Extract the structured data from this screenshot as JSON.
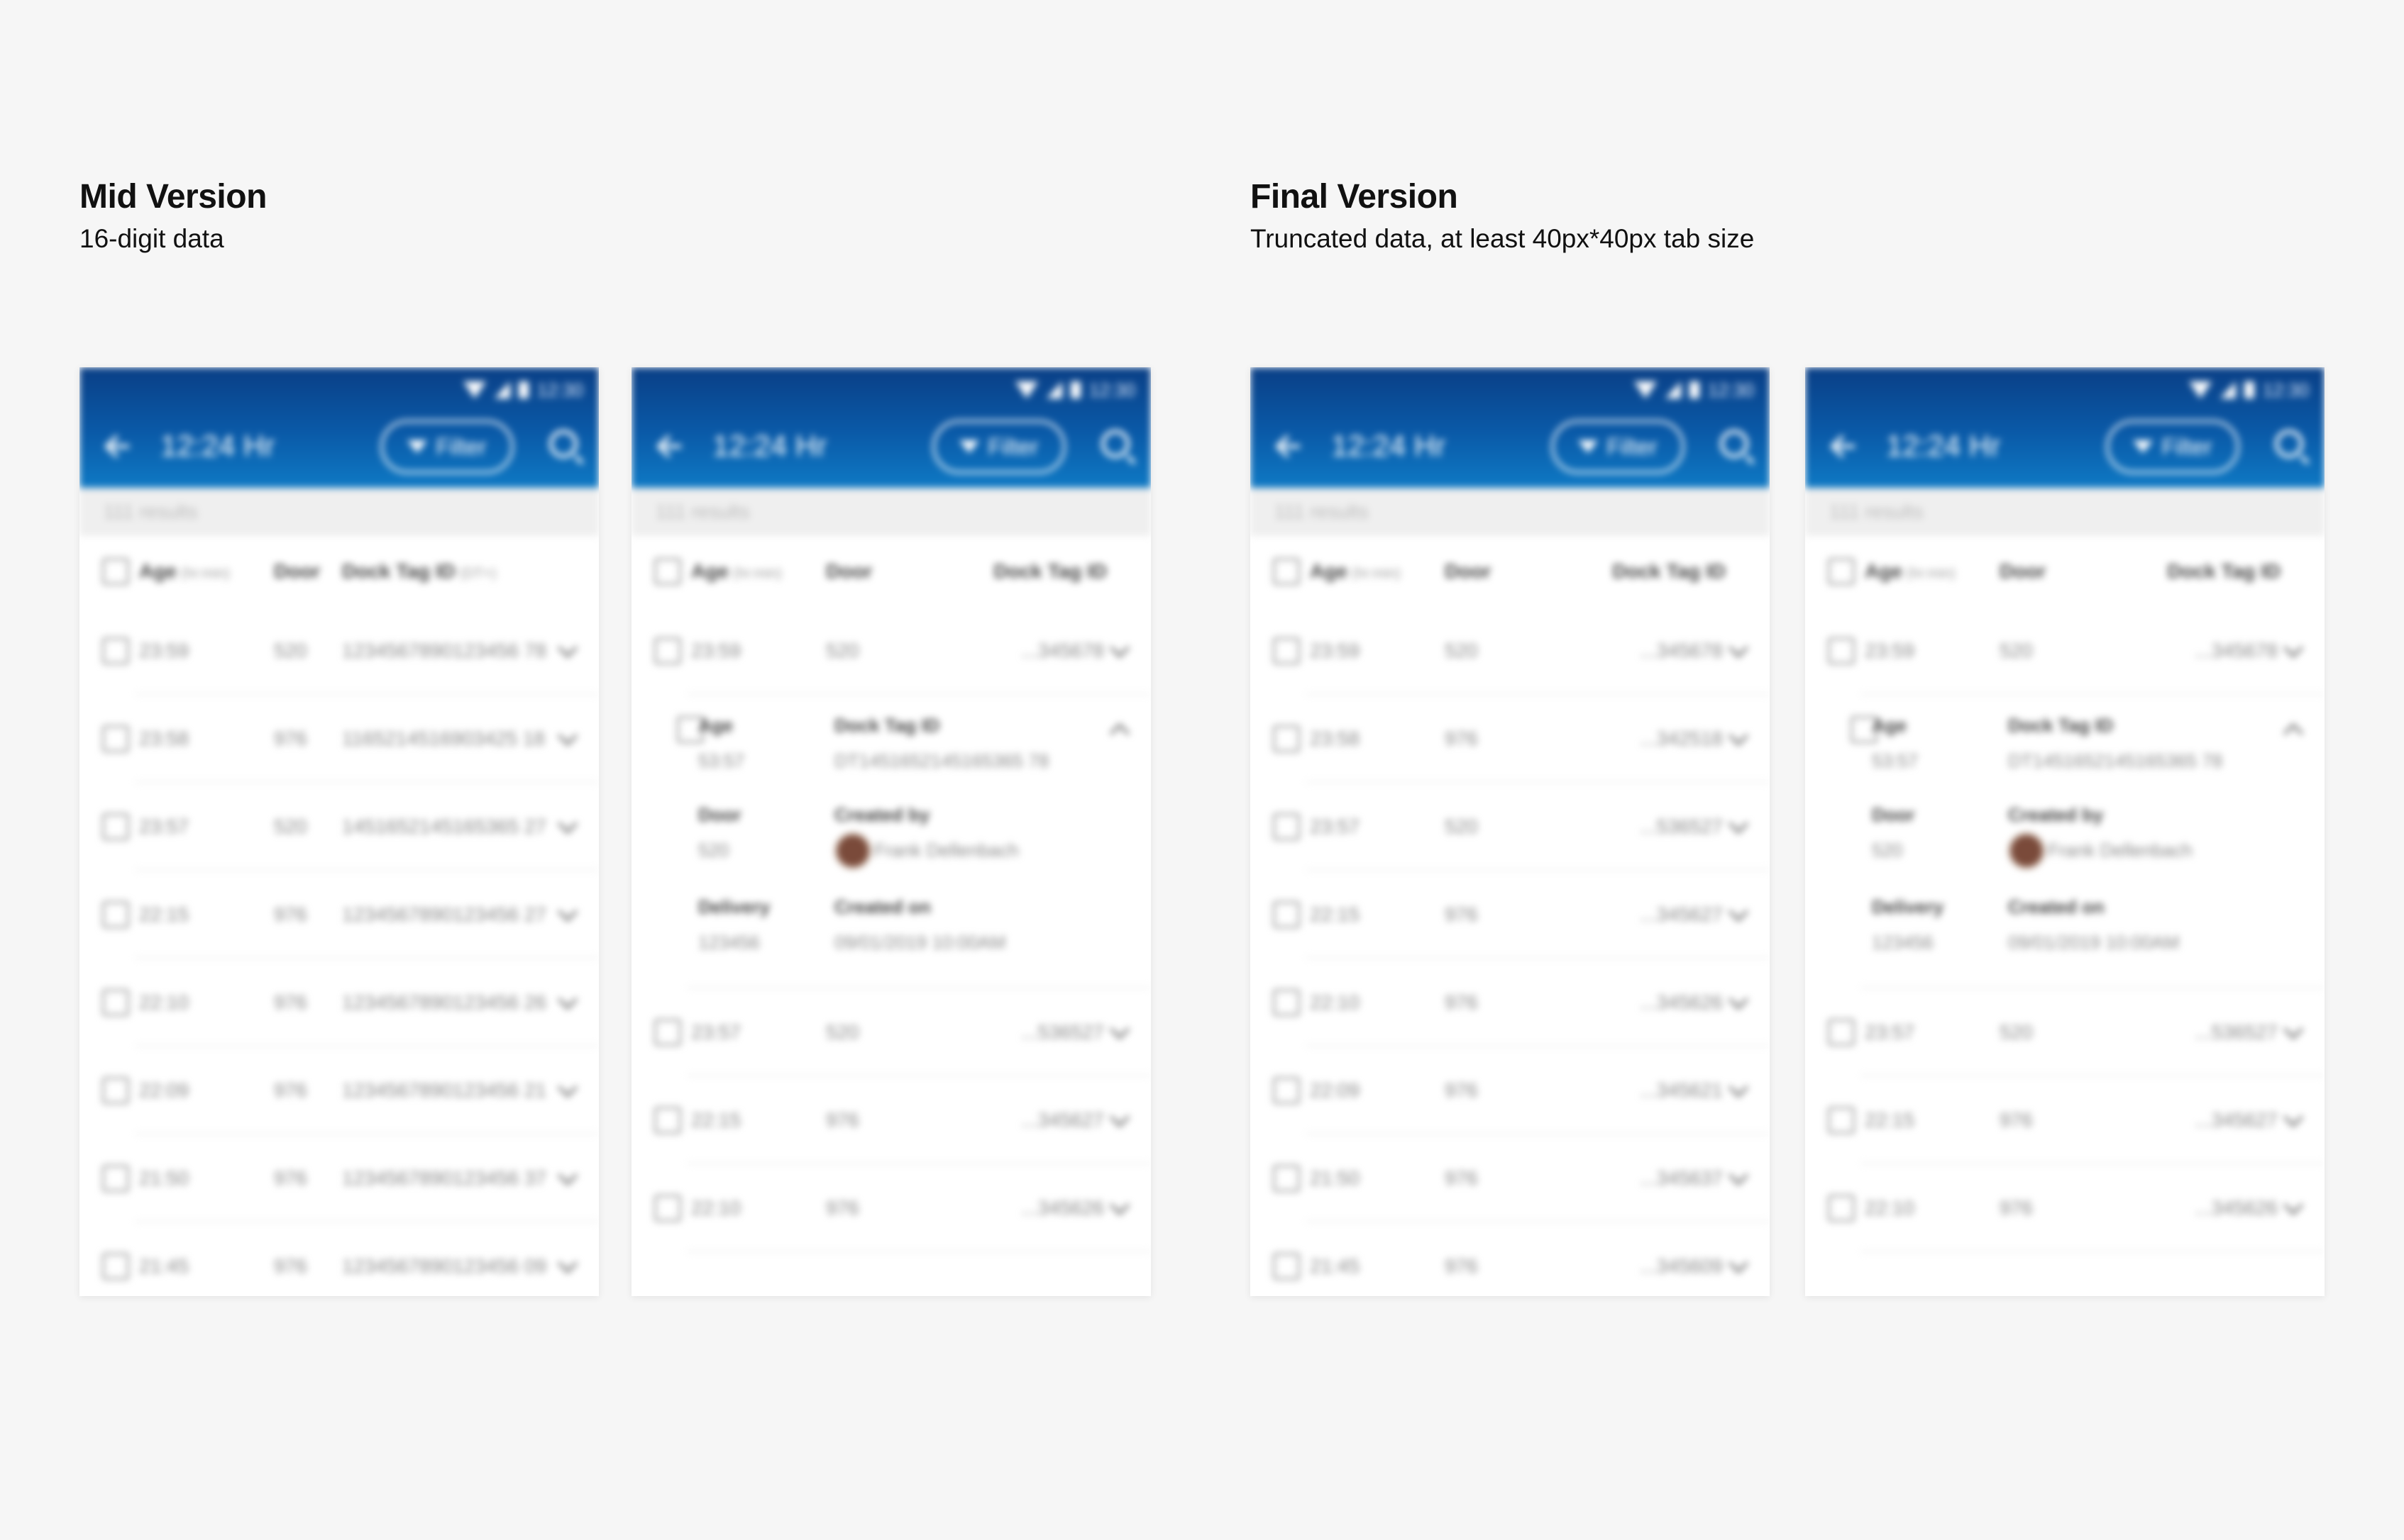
{
  "sections": [
    {
      "title": "Mid Version",
      "subtitle": "16-digit data"
    },
    {
      "title": "Final Version",
      "subtitle": "Truncated data, at least 40px*40px tab size"
    }
  ],
  "phone": {
    "status_time": "12:30",
    "title": "12:24 Hr",
    "filter_label": "Filter",
    "results": "111 results",
    "col_age": "Age",
    "col_age_hint": "(hr:min)",
    "col_door": "Door",
    "col_tag": "Dock Tag ID",
    "col_tag_hint": "(DT+)"
  },
  "screens": {
    "mid_full": {
      "rows": [
        {
          "age": "23:59",
          "door": "520",
          "tag": "1234567890123456 78"
        },
        {
          "age": "23:58",
          "door": "976",
          "tag": "1165214516903425 18"
        },
        {
          "age": "23:57",
          "door": "520",
          "tag": "1451652145165365 27"
        },
        {
          "age": "22:15",
          "door": "976",
          "tag": "1234567890123456 27"
        },
        {
          "age": "22:10",
          "door": "976",
          "tag": "1234567890123456 26"
        },
        {
          "age": "22:09",
          "door": "976",
          "tag": "1234567890123456 21"
        },
        {
          "age": "21:50",
          "door": "976",
          "tag": "1234567890123456 37"
        },
        {
          "age": "21:45",
          "door": "976",
          "tag": "1234567890123456 09"
        }
      ]
    },
    "mid_expanded": {
      "row_first": {
        "age": "23:59",
        "door": "520",
        "tag": "...345678"
      },
      "detail": {
        "age_label": "Age",
        "age_value": "53:57",
        "tag_label": "Dock Tag ID",
        "tag_value": "DT1451652145165365 78",
        "door_label": "Door",
        "door_value": "520",
        "created_by_label": "Created by",
        "created_by_value": "Frank Dellenbach",
        "delivery_label": "Delivery",
        "delivery_value": "123456",
        "created_on_label": "Created on",
        "created_on_value": "09/01/2019 10:00AM"
      },
      "rows_after": [
        {
          "age": "23:57",
          "door": "520",
          "tag": "...536527"
        },
        {
          "age": "22:15",
          "door": "976",
          "tag": "...345627"
        },
        {
          "age": "22:10",
          "door": "976",
          "tag": "...345626"
        }
      ]
    },
    "final_full": {
      "rows": [
        {
          "age": "23:59",
          "door": "520",
          "tag": "...345678"
        },
        {
          "age": "23:58",
          "door": "976",
          "tag": "...342518"
        },
        {
          "age": "23:57",
          "door": "520",
          "tag": "...536527"
        },
        {
          "age": "22:15",
          "door": "976",
          "tag": "...345627"
        },
        {
          "age": "22:10",
          "door": "976",
          "tag": "...345626"
        },
        {
          "age": "22:09",
          "door": "976",
          "tag": "...345621"
        },
        {
          "age": "21:50",
          "door": "976",
          "tag": "...345637"
        },
        {
          "age": "21:45",
          "door": "976",
          "tag": "...345609"
        }
      ]
    },
    "final_expanded": {
      "row_first": {
        "age": "23:59",
        "door": "520",
        "tag": "...345678"
      },
      "detail": {
        "age_label": "Age",
        "age_value": "53:57",
        "tag_label": "Dock Tag ID",
        "tag_value": "DT1451652145165365 78",
        "door_label": "Door",
        "door_value": "520",
        "created_by_label": "Created by",
        "created_by_value": "Frank Dellenbach",
        "delivery_label": "Delivery",
        "delivery_value": "123456",
        "created_on_label": "Created on",
        "created_on_value": "09/01/2019 10:00AM"
      },
      "rows_after": [
        {
          "age": "23:57",
          "door": "520",
          "tag": "...536527"
        },
        {
          "age": "22:15",
          "door": "976",
          "tag": "...345627"
        },
        {
          "age": "22:10",
          "door": "976",
          "tag": "...345626"
        }
      ]
    }
  }
}
